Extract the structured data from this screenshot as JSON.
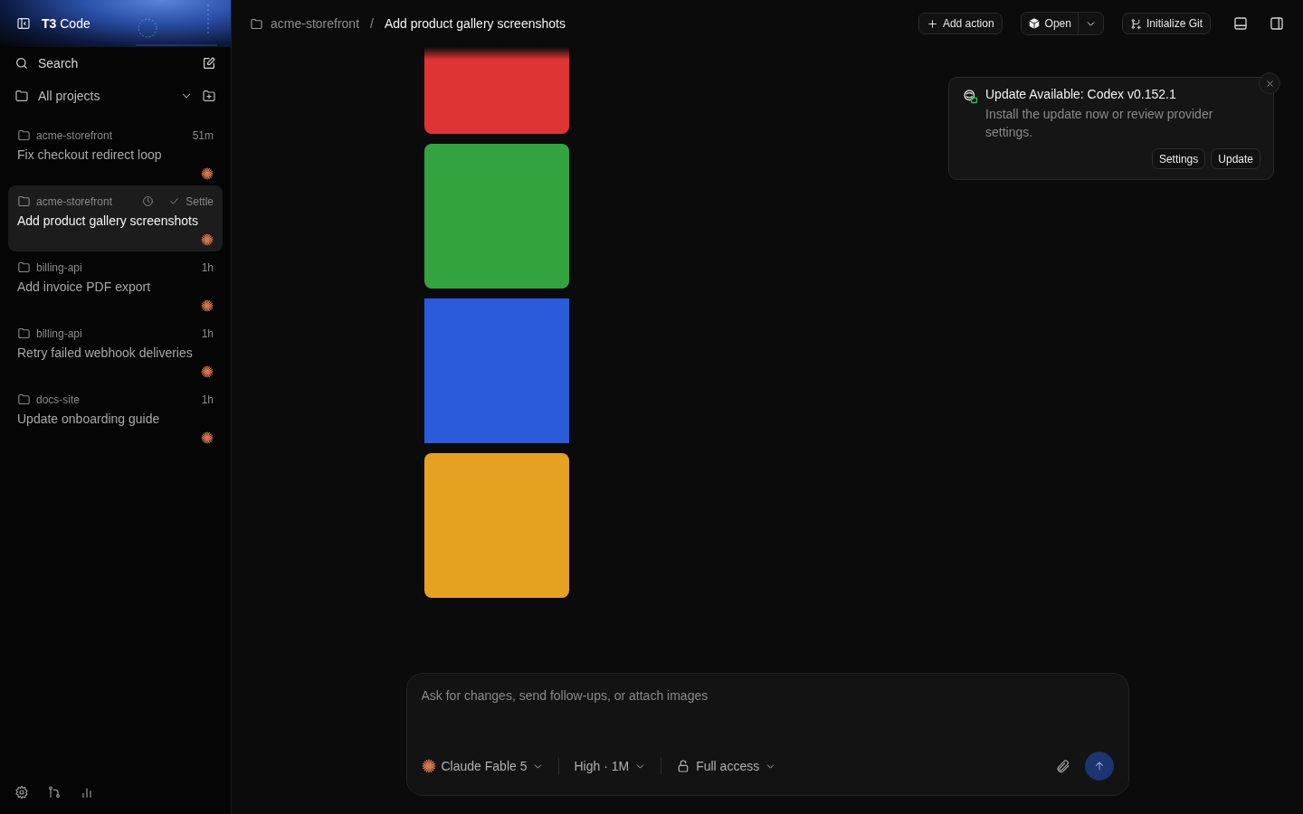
{
  "sidebar": {
    "brand": {
      "mark": "T3",
      "name": "Code"
    },
    "search": "Search",
    "project_filter": "All projects",
    "threads": [
      {
        "project": "acme-storefront",
        "time": "51m",
        "title": "Fix checkout redirect loop",
        "selected": false
      },
      {
        "project": "acme-storefront",
        "status": "Settle",
        "title": "Add product gallery screenshots",
        "selected": true
      },
      {
        "project": "billing-api",
        "time": "1h",
        "title": "Add invoice PDF export",
        "selected": false
      },
      {
        "project": "billing-api",
        "time": "1h",
        "title": "Retry failed webhook deliveries",
        "selected": false
      },
      {
        "project": "docs-site",
        "time": "1h",
        "title": "Update onboarding guide",
        "selected": false
      }
    ]
  },
  "header": {
    "breadcrumb": {
      "project": "acme-storefront",
      "separator": "/",
      "thread": "Add product gallery screenshots"
    },
    "buttons": {
      "add_action": "Add action",
      "open": "Open",
      "init_git": "Initialize Git"
    }
  },
  "images": [
    {
      "color": "#de3434"
    },
    {
      "color": "#33a340"
    },
    {
      "color": "#2a5bdb"
    },
    {
      "color": "#e5a121"
    }
  ],
  "toast": {
    "title": "Update Available: Codex v0.152.1",
    "body": "Install the update now or review provider settings.",
    "buttons": [
      "Settings",
      "Update"
    ]
  },
  "composer": {
    "placeholder": "Ask for changes, send follow-ups, or attach images",
    "model": "Claude Fable 5",
    "effort": "High · 1M",
    "access": "Full access"
  }
}
